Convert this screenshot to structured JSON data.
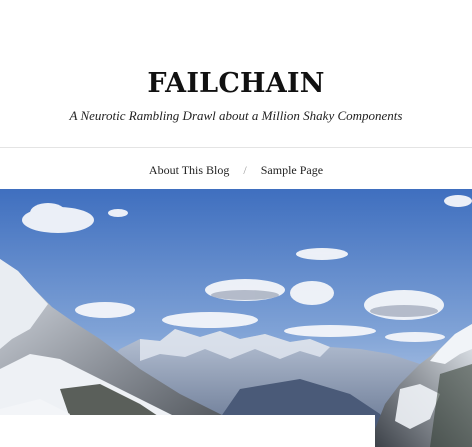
{
  "site": {
    "title": "FAILCHAIN",
    "tagline": "A Neurotic Rambling Drawl about a Million Shaky Components"
  },
  "nav": {
    "items": [
      {
        "label": "About This Blog"
      },
      {
        "label": "Sample Page"
      }
    ],
    "separator": "/"
  },
  "colors": {
    "sky_top": "#4a78c2",
    "sky_bottom": "#c7d8ef",
    "mountain": "#7d8aa3",
    "snow": "#eef2f7",
    "text": "#111111"
  }
}
